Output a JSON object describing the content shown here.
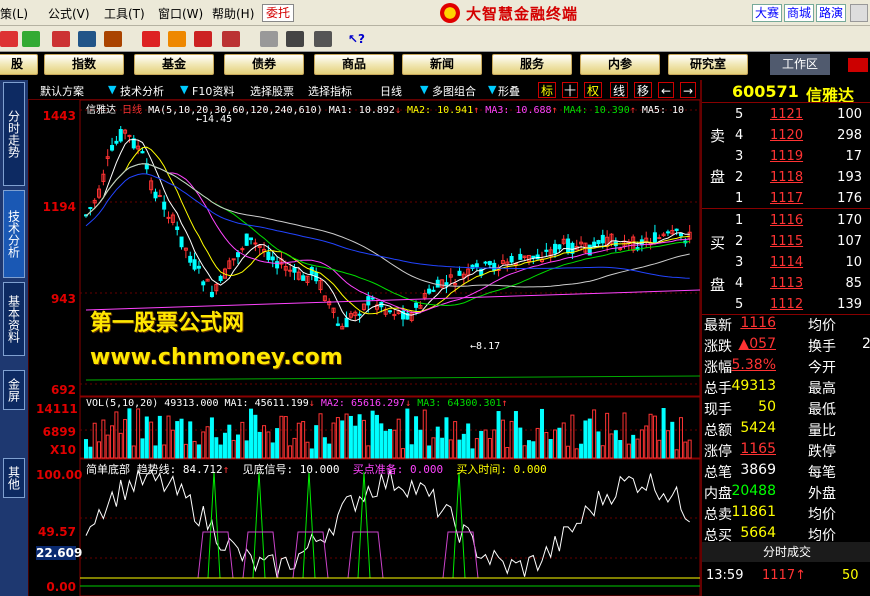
{
  "menu": {
    "items": [
      "策(L)",
      "公式(V)",
      "工具(T)",
      "窗口(W)",
      "帮助(H)"
    ],
    "weituo": "委托",
    "brand": "大智慧金融终端",
    "right_buttons": [
      "大赛",
      "商城",
      "路演"
    ]
  },
  "nav": {
    "buttons": [
      "股",
      "指数",
      "基金",
      "债券",
      "商品",
      "新闻",
      "服务",
      "内参",
      "研究室"
    ],
    "workzone": "工作区"
  },
  "sidebar": {
    "tabs": [
      "分时走势",
      "技术分析",
      "基本资料",
      "金屏",
      "其他"
    ]
  },
  "chartbar": {
    "items": [
      "默认方案",
      "技术分析",
      "F10资料",
      "选择股票",
      "选择指标",
      "日线",
      "多图组合",
      "形叠"
    ],
    "boxes": [
      "标",
      "十",
      "权",
      "线",
      "移",
      "←",
      "→"
    ]
  },
  "main_chart": {
    "stock": "信雅达",
    "period": "日线",
    "ma_params": "MA(5,10,20,30,60,120,240,610)",
    "ma": [
      {
        "label": "MA1: 10.892",
        "color": "#ffffff"
      },
      {
        "label": "MA2: 10.941",
        "color": "#ffff00"
      },
      {
        "label": "MA3: 10.688",
        "color": "#ff44ff"
      },
      {
        "label": "MA4: 10.390",
        "color": "#00dd00"
      },
      {
        "label": "MA5: 10",
        "color": "#ffffff"
      }
    ],
    "axis_labels": [
      "1443",
      "1194",
      "943",
      "692"
    ],
    "high_annot": "14.45",
    "low_annot": "8.17"
  },
  "volume": {
    "header": "VOL(5,10,20)",
    "value": "49313.000",
    "ma1": "MA1: 45611.199",
    "ma2": "MA2: 65616.297",
    "ma3": "MA3: 64300.301",
    "axis_labels": [
      "14111",
      "6899",
      "X10"
    ]
  },
  "indicator": {
    "name": "简单底部",
    "trend": "趋势线: 84.712",
    "signal": "见底信号: 10.000",
    "buy_prep": "买点准备: 0.000",
    "buy_time": "买入时间: 0.000",
    "axis_labels": [
      "100.00",
      "49.57",
      "22.609",
      "0.00"
    ]
  },
  "watermark": {
    "line1": "第一股票公式网",
    "line2": "www.chnmoney.com"
  },
  "quote": {
    "code": "600571",
    "name": "信雅达",
    "sell_side": "卖盘",
    "buy_side": "买盘",
    "sell": [
      {
        "idx": "5",
        "price": "1121",
        "vol": "100"
      },
      {
        "idx": "4",
        "price": "1120",
        "vol": "298"
      },
      {
        "idx": "3",
        "price": "1119",
        "vol": "17"
      },
      {
        "idx": "2",
        "price": "1118",
        "vol": "193"
      },
      {
        "idx": "1",
        "price": "1117",
        "vol": "176"
      }
    ],
    "buy": [
      {
        "idx": "1",
        "price": "1116",
        "vol": "170"
      },
      {
        "idx": "2",
        "price": "1115",
        "vol": "107"
      },
      {
        "idx": "3",
        "price": "1114",
        "vol": "10"
      },
      {
        "idx": "4",
        "price": "1113",
        "vol": "85"
      },
      {
        "idx": "5",
        "price": "1112",
        "vol": "139"
      }
    ],
    "stats": [
      {
        "label": "最新",
        "value": "1116",
        "color": "#ff3333",
        "label2": "均价"
      },
      {
        "label": "涨跌",
        "value": "▲057",
        "color": "#ff3333",
        "label2": "换手"
      },
      {
        "label": "涨幅",
        "value": "5.38%",
        "color": "#ff3333",
        "label2": "今开"
      },
      {
        "label": "总手",
        "value": "49313",
        "color": "#ffff00",
        "label2": "最高"
      },
      {
        "label": "现手",
        "value": "50",
        "color": "#ffff00",
        "label2": "最低"
      },
      {
        "label": "总额",
        "value": "5424",
        "color": "#ffff00",
        "label2": "量比"
      },
      {
        "label": "涨停",
        "value": "1165",
        "color": "#ff3333",
        "label2": "跌停"
      },
      {
        "label": "总笔",
        "value": "3869",
        "color": "#ffffff",
        "label2": "每笔"
      },
      {
        "label": "内盘",
        "value": "20488",
        "color": "#00ff00",
        "label2": "外盘"
      },
      {
        "label": "总卖",
        "value": "11861",
        "color": "#ffff00",
        "label2": "均价"
      },
      {
        "label": "总买",
        "value": "5664",
        "color": "#ffff00",
        "label2": "均价"
      }
    ],
    "huanshou_partial": "2",
    "tick_header": "分时成交",
    "ticks": [
      {
        "time": "13:59",
        "price": "1117↑",
        "vol": "50"
      }
    ]
  },
  "colors": {
    "up": "#ff3333",
    "down": "#00ffff",
    "border": "#880000",
    "text_yellow": "#ffff00"
  }
}
